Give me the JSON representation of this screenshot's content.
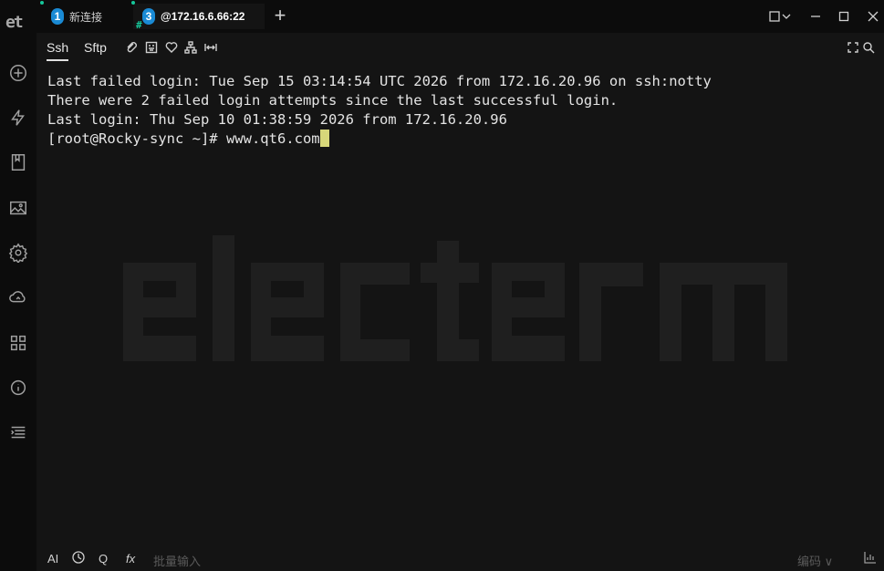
{
  "app": {
    "logo_text": "et"
  },
  "tabs": [
    {
      "number": "1",
      "label": "新连接",
      "active": false
    },
    {
      "number": "3",
      "label": "@172.16.6.66:22",
      "active": true,
      "marker": "#"
    }
  ],
  "add_tab_label": "+",
  "subbar": {
    "tabs": [
      {
        "label": "Ssh",
        "active": true
      },
      {
        "label": "Sftp",
        "active": false
      }
    ],
    "icons": [
      "paperclip-icon",
      "keyboard-icon",
      "heart-icon",
      "network-icon",
      "resize-width-icon"
    ],
    "right_icons": [
      "fullscreen-icon",
      "search-icon"
    ]
  },
  "terminal": {
    "lines": [
      "Last failed login: Tue Sep 15 03:14:54 UTC 2026 from 172.16.20.96 on ssh:notty",
      "There were 2 failed login attempts since the last successful login.",
      "Last login: Thu Sep 10 01:38:59 2026 from 172.16.20.96",
      "[root@Rocky-sync ~]# www.qt6.com"
    ],
    "watermark": "electerm"
  },
  "sidebar": {
    "icons": [
      "plus-circle-icon",
      "bolt-icon",
      "bookmark-icon",
      "image-icon",
      "gear-icon",
      "cloud-sync-icon",
      "grid-icon",
      "info-icon",
      "list-icon"
    ]
  },
  "bottombar": {
    "ai_label": "AI",
    "q_label": "Q",
    "fx_label": "fx",
    "batch_input_placeholder": "批量输入",
    "encoding_label": "编码 ∨"
  },
  "colors": {
    "background": "#141414",
    "accent_badge": "#1a8ad4",
    "status_dot": "#16c79a",
    "cursor": "#d7d77a"
  }
}
